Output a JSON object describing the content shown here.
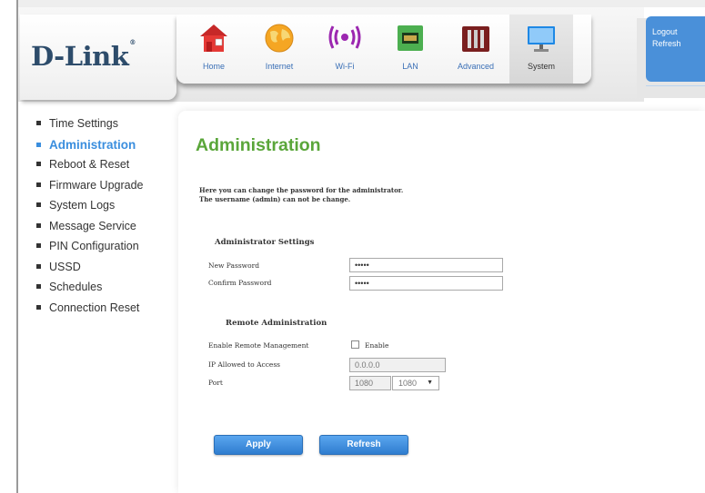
{
  "brand": {
    "name": "D-Link",
    "mark": "®"
  },
  "nav": [
    {
      "label": "Home",
      "icon": "home-icon"
    },
    {
      "label": "Internet",
      "icon": "globe-icon"
    },
    {
      "label": "Wi-Fi",
      "icon": "wifi-icon"
    },
    {
      "label": "LAN",
      "icon": "lan-icon"
    },
    {
      "label": "Advanced",
      "icon": "tools-icon"
    },
    {
      "label": "System",
      "icon": "monitor-icon"
    }
  ],
  "nav_active": "System",
  "side_links": {
    "logout": "Logout",
    "refresh": "Refresh"
  },
  "menu": [
    "Time Settings",
    "Administration",
    "Reboot & Reset",
    "Firmware Upgrade",
    "System Logs",
    "Message Service",
    "PIN Configuration",
    "USSD",
    "Schedules",
    "Connection Reset"
  ],
  "menu_active": "Administration",
  "page": {
    "title": "Administration",
    "desc_line1": "Here you can change the password for the administrator.",
    "desc_line2": "The username (admin) can not be change."
  },
  "admin_settings": {
    "title": "Administrator Settings",
    "new_password_label": "New Password",
    "new_password_value": "•••••",
    "confirm_password_label": "Confirm Password",
    "confirm_password_value": "•••••"
  },
  "remote_admin": {
    "title": "Remote Administration",
    "enable_label": "Enable Remote Management",
    "enable_checkbox_label": "Enable",
    "enabled": false,
    "ip_label": "IP Allowed to Access",
    "ip_value": "0.0.0.0",
    "port_label": "Port",
    "port_value": "1080",
    "port_select": "1080"
  },
  "buttons": {
    "apply": "Apply",
    "refresh": "Refresh"
  },
  "colors": {
    "title_green": "#5aa63a",
    "link_blue": "#3a6fb6",
    "accent_blue": "#3a8ede",
    "logo_navy": "#2d4c6b"
  }
}
